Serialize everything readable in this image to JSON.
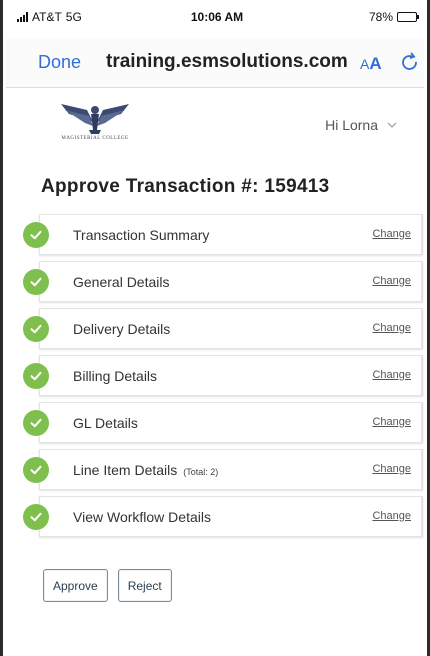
{
  "status_bar": {
    "carrier": "AT&T",
    "network": "5G",
    "time": "10:06 AM",
    "battery": "78%",
    "battery_level": 0.78
  },
  "browser": {
    "done_label": "Done",
    "url": "training.esmsolutions.com",
    "text_size_label_small": "A",
    "text_size_label_large": "A",
    "reload_icon": "reload-icon"
  },
  "header": {
    "logo_caption": "MAGISTERIAL COLLEGE",
    "greeting": "Hi Lorna",
    "menu_icon": "chevron-down-icon"
  },
  "page": {
    "title": "Approve Transaction #: 159413"
  },
  "sections": [
    {
      "label": "Transaction Summary",
      "note": "",
      "change_label": "Change"
    },
    {
      "label": "General Details",
      "note": "",
      "change_label": "Change"
    },
    {
      "label": "Delivery Details",
      "note": "",
      "change_label": "Change"
    },
    {
      "label": "Billing Details",
      "note": "",
      "change_label": "Change"
    },
    {
      "label": "GL Details",
      "note": "",
      "change_label": "Change"
    },
    {
      "label": "Line Item Details",
      "note": "(Total: 2)",
      "change_label": "Change"
    },
    {
      "label": "View Workflow Details",
      "note": "",
      "change_label": "Change"
    }
  ],
  "actions": {
    "approve_label": "Approve",
    "reject_label": "Reject"
  },
  "colors": {
    "link_blue": "#2f6fd6",
    "check_green": "#7fbf4d",
    "button_border": "#7a8a99"
  }
}
